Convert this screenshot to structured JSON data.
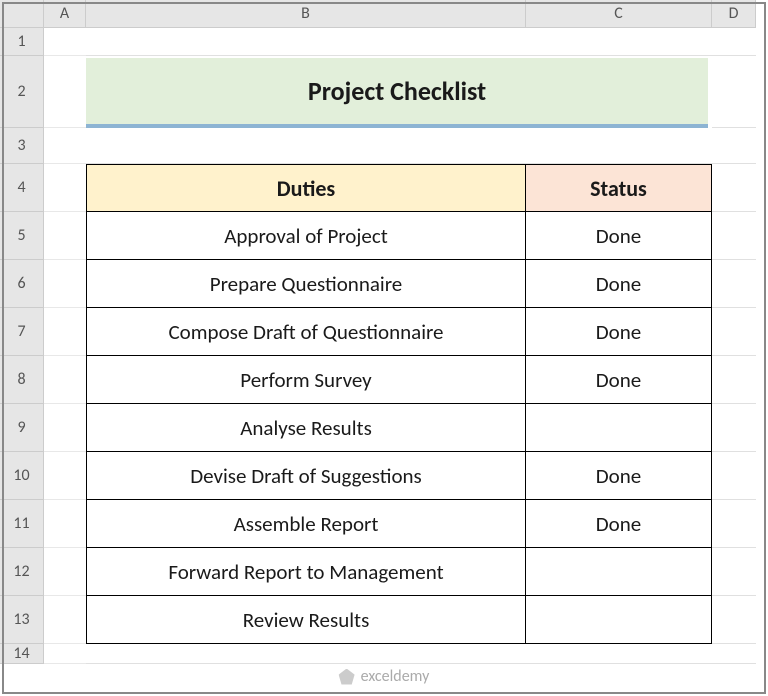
{
  "columns": [
    "A",
    "B",
    "C",
    "D"
  ],
  "rows": [
    "1",
    "2",
    "3",
    "4",
    "5",
    "6",
    "7",
    "8",
    "9",
    "10",
    "11",
    "12",
    "13",
    "14"
  ],
  "title": "Project Checklist",
  "headers": {
    "duties": "Duties",
    "status": "Status"
  },
  "data": [
    {
      "duty": "Approval of Project",
      "status": "Done"
    },
    {
      "duty": "Prepare Questionnaire",
      "status": "Done"
    },
    {
      "duty": "Compose Draft of Questionnaire",
      "status": "Done"
    },
    {
      "duty": "Perform Survey",
      "status": "Done"
    },
    {
      "duty": "Analyse Results",
      "status": ""
    },
    {
      "duty": "Devise Draft of Suggestions",
      "status": "Done"
    },
    {
      "duty": "Assemble Report",
      "status": "Done"
    },
    {
      "duty": "Forward Report to Management",
      "status": ""
    },
    {
      "duty": "Review Results",
      "status": ""
    }
  ],
  "watermark": "exceldemy"
}
